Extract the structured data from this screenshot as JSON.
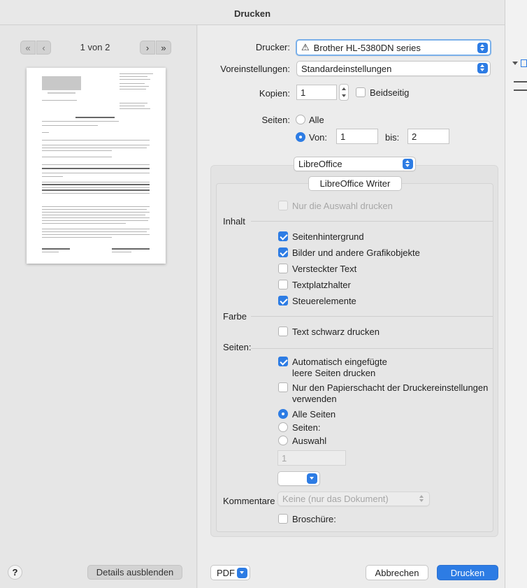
{
  "dialog": {
    "title": "Drucken"
  },
  "preview": {
    "page_counter": "1 von 2",
    "nav_first_glyph": "«",
    "nav_prev_glyph": "‹",
    "nav_next_glyph": "›",
    "nav_last_glyph": "»"
  },
  "form": {
    "printer_label": "Drucker:",
    "printer_value": "Brother HL-5380DN series",
    "presets_label": "Voreinstellungen:",
    "presets_value": "Standardeinstellungen",
    "copies_label": "Kopien:",
    "copies_value": "1",
    "duplex_label": "Beidseitig",
    "pages_label": "Seiten:",
    "pages_all": "Alle",
    "pages_from_label": "Von:",
    "pages_from_value": "1",
    "pages_to_label": "bis:",
    "pages_to_value": "2",
    "section_popup": "LibreOffice"
  },
  "libreoffice": {
    "tab_label": "LibreOffice Writer",
    "selection_only": "Nur die Auswahl drucken",
    "content_heading": "Inhalt",
    "content_items": [
      {
        "label": "Seitenhintergrund",
        "checked": true
      },
      {
        "label": "Bilder und andere Grafikobjekte",
        "checked": true
      },
      {
        "label": "Versteckter Text",
        "checked": false
      },
      {
        "label": "Textplatzhalter",
        "checked": false
      },
      {
        "label": "Steuerelemente",
        "checked": true
      }
    ],
    "color_heading": "Farbe",
    "black_text": "Text schwarz drucken",
    "pages_heading": "Seiten:",
    "auto_blank_line1": "Automatisch eingefügte",
    "auto_blank_line2": "leere Seiten drucken",
    "paper_tray_line1": "Nur den Papierschacht der Druckereinstellungen",
    "paper_tray_line2": "verwenden",
    "all_pages": "Alle Seiten",
    "pages_option": "Seiten:",
    "selection_option": "Auswahl",
    "pages_range_value": "1",
    "comments_label": "Kommentare",
    "comments_value": "Keine (nur das Dokument)",
    "brochure_label": "Broschüre:"
  },
  "footer": {
    "help": "?",
    "details_button": "Details ausblenden",
    "pdf_button": "PDF",
    "cancel_button": "Abbrechen",
    "print_button": "Drucken"
  },
  "colors": {
    "accent": "#2d7ce4"
  },
  "icons": {
    "warning": "warning-icon",
    "help": "help-icon"
  }
}
